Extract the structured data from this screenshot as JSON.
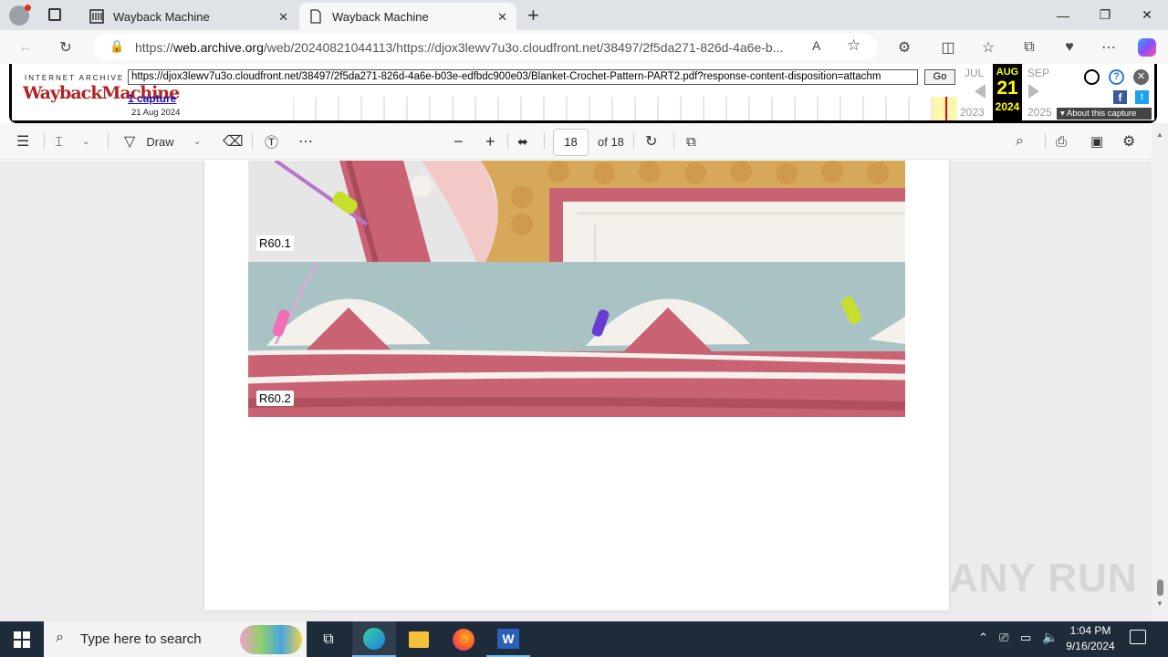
{
  "browser": {
    "tabs": [
      {
        "title": "Wayback Machine",
        "active": false
      },
      {
        "title": "Wayback Machine",
        "active": true
      }
    ],
    "address": {
      "prefix": "https://",
      "host": "web.archive.org",
      "path": "/web/20240821044113/https://djox3lewv7u3o.cloudfront.net/38497/2f5da271-826d-4a6e-b..."
    }
  },
  "wayback": {
    "logo_top": "INTERNET ARCHIVE",
    "logo": "WaybackMachine",
    "url_value": "https://djox3lewv7u3o.cloudfront.net/38497/2f5da271-826d-4a6e-b03e-edfbdc900e03/Blanket-Crochet-Pattern-PART2.pdf?response-content-disposition=attachm",
    "go_label": "Go",
    "captures": "1 capture",
    "capture_date": "21 Aug 2024",
    "prev_month": "JUL",
    "cur_month": "AUG",
    "next_month": "SEP",
    "cur_day": "21",
    "prev_year": "2023",
    "cur_year": "2024",
    "next_year": "2025",
    "about": "About this capture"
  },
  "pdf": {
    "draw_label": "Draw",
    "page_number": "18",
    "page_total": "of 18",
    "labels": [
      "R60.1",
      "R60.2"
    ]
  },
  "taskbar": {
    "search_placeholder": "Type here to search",
    "time": "1:04 PM",
    "date": "9/16/2024"
  },
  "watermark": "ANY RUN",
  "colors": {
    "yarn_pink": "#c96273",
    "yarn_white": "#f4f1ec",
    "yarn_mustard": "#d8a85a",
    "taskbar": "#1d2b3a",
    "wayback_red": "#b22222"
  }
}
